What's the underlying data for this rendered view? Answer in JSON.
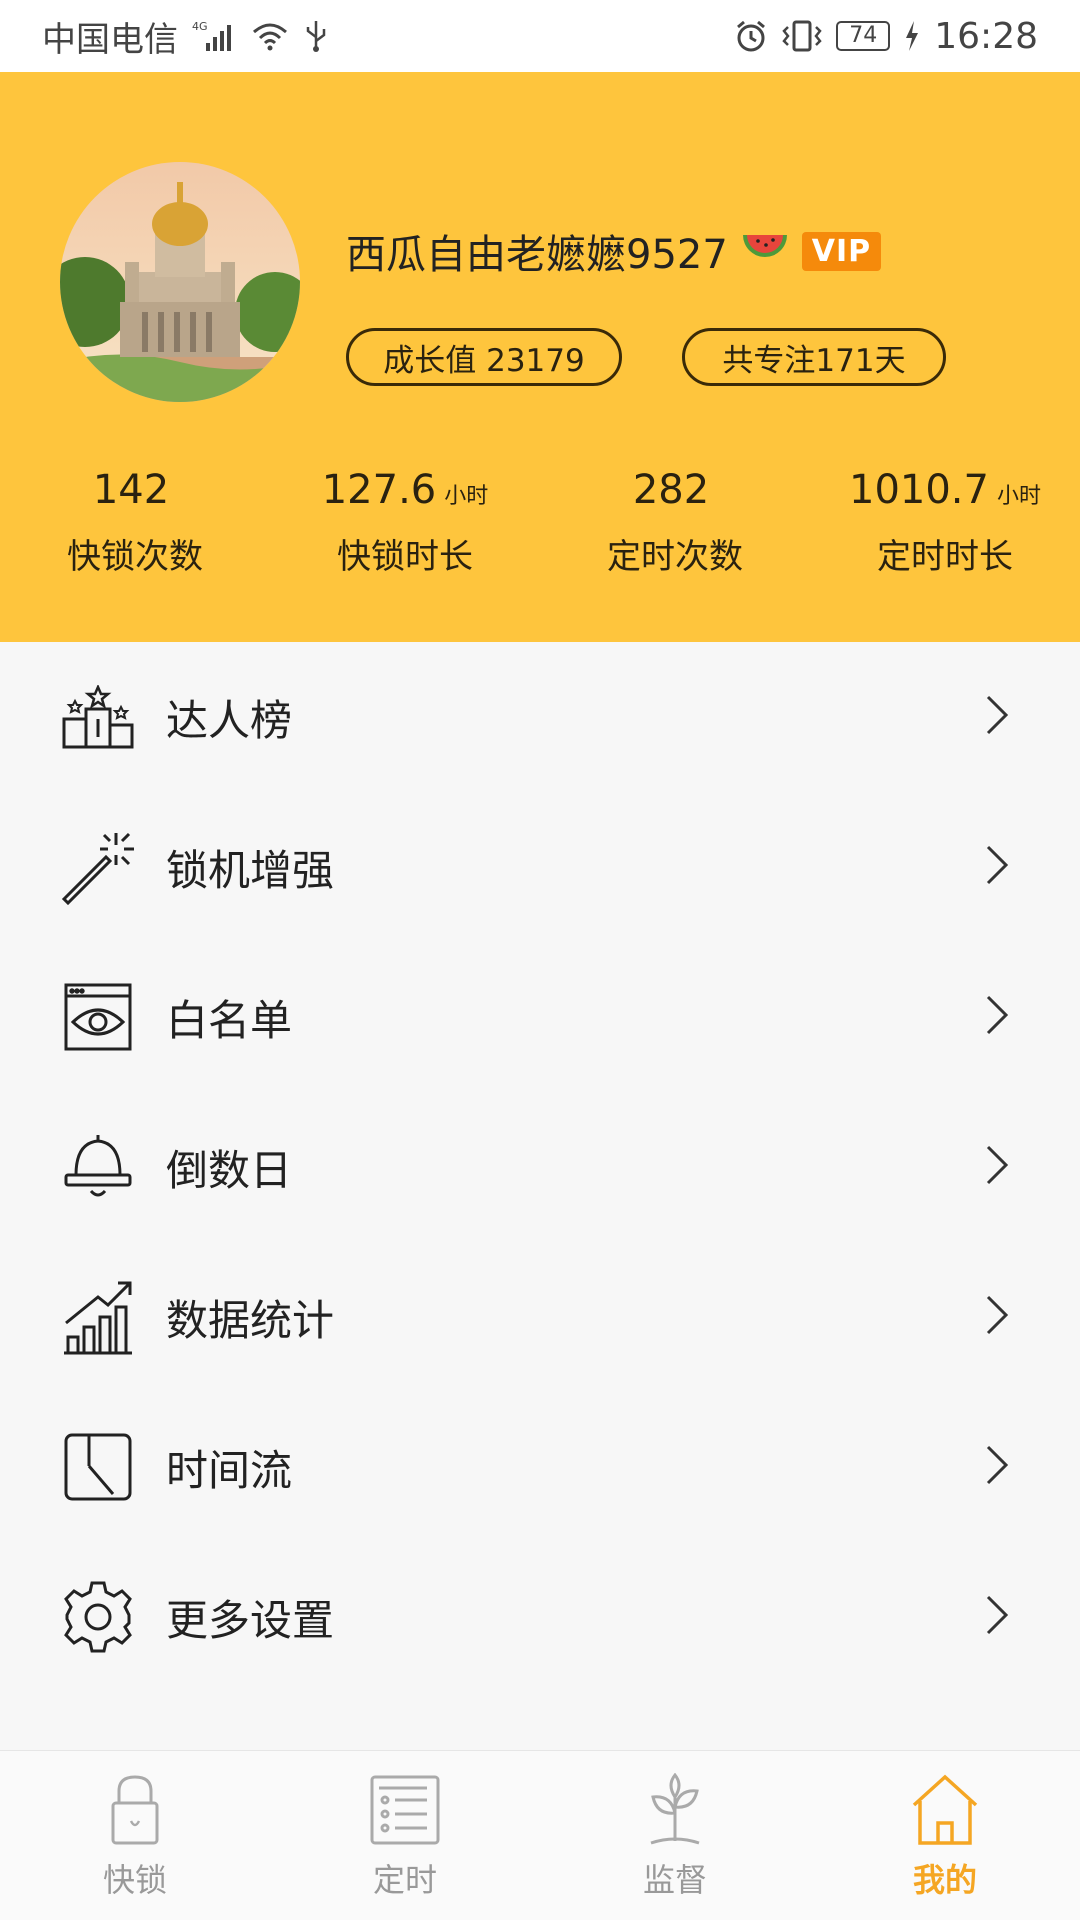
{
  "status_bar": {
    "carrier": "中国电信",
    "network": "4G",
    "battery": "74",
    "time": "16:28"
  },
  "profile": {
    "username": "西瓜自由老嬷嬷9527",
    "vip_label": "VIP",
    "growth_badge": "成长值 23179",
    "focus_badge": "共专注171天"
  },
  "stats": [
    {
      "value": "142",
      "unit": "",
      "label": "快锁次数"
    },
    {
      "value": "127.6",
      "unit": "小时",
      "label": "快锁时长"
    },
    {
      "value": "282",
      "unit": "",
      "label": "定时次数"
    },
    {
      "value": "1010.7",
      "unit": "小时",
      "label": "定时时长"
    }
  ],
  "menu": [
    {
      "label": "达人榜",
      "icon": "podium-icon"
    },
    {
      "label": "锁机增强",
      "icon": "magic-wand-icon"
    },
    {
      "label": "白名单",
      "icon": "eye-window-icon"
    },
    {
      "label": "倒数日",
      "icon": "bell-icon"
    },
    {
      "label": "数据统计",
      "icon": "chart-icon"
    },
    {
      "label": "时间流",
      "icon": "clock-icon"
    },
    {
      "label": "更多设置",
      "icon": "gear-icon"
    }
  ],
  "bottom_nav": [
    {
      "label": "快锁",
      "icon": "lock-icon",
      "active": false
    },
    {
      "label": "定时",
      "icon": "list-icon",
      "active": false
    },
    {
      "label": "监督",
      "icon": "plant-icon",
      "active": false
    },
    {
      "label": "我的",
      "icon": "home-icon",
      "active": true
    }
  ],
  "colors": {
    "header_bg": "#fec53d",
    "vip_bg": "#f58a0b",
    "active_nav": "#f5a623",
    "inactive_nav": "#999999"
  }
}
